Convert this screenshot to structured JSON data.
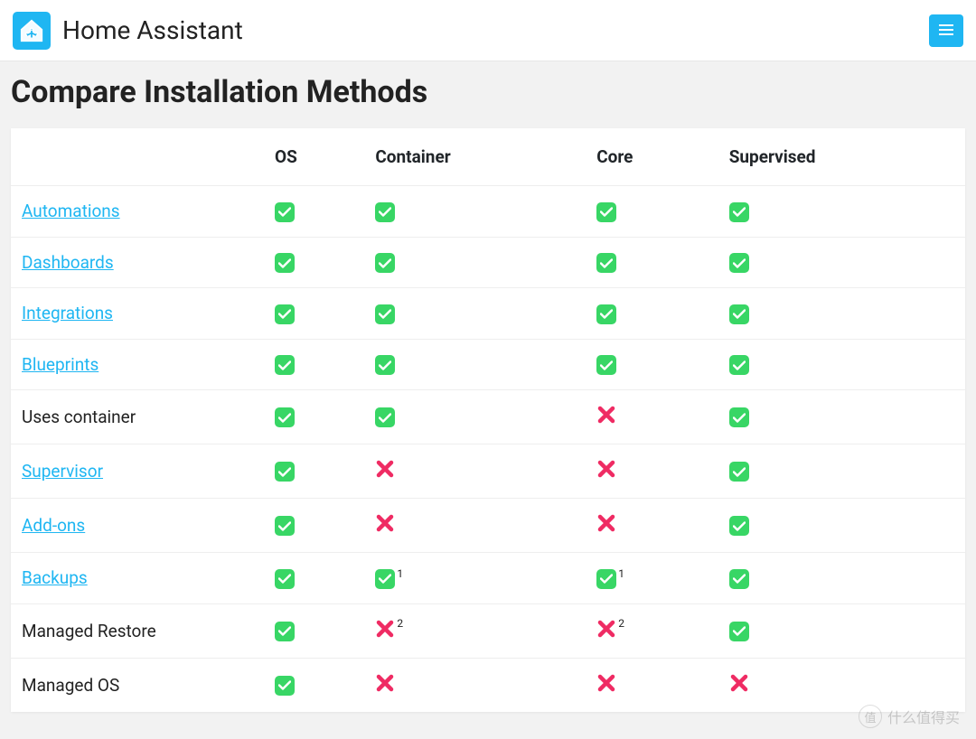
{
  "brand": "Home Assistant",
  "page_title": "Compare Installation Methods",
  "columns": {
    "c1": "OS",
    "c2": "Container",
    "c3": "Core",
    "c4": "Supervised"
  },
  "rows": [
    {
      "label": "Automations",
      "link": true,
      "cells": [
        [
          "yes",
          ""
        ],
        [
          "yes",
          ""
        ],
        [
          "yes",
          ""
        ],
        [
          "yes",
          ""
        ]
      ]
    },
    {
      "label": "Dashboards",
      "link": true,
      "cells": [
        [
          "yes",
          ""
        ],
        [
          "yes",
          ""
        ],
        [
          "yes",
          ""
        ],
        [
          "yes",
          ""
        ]
      ]
    },
    {
      "label": "Integrations",
      "link": true,
      "cells": [
        [
          "yes",
          ""
        ],
        [
          "yes",
          ""
        ],
        [
          "yes",
          ""
        ],
        [
          "yes",
          ""
        ]
      ]
    },
    {
      "label": "Blueprints",
      "link": true,
      "cells": [
        [
          "yes",
          ""
        ],
        [
          "yes",
          ""
        ],
        [
          "yes",
          ""
        ],
        [
          "yes",
          ""
        ]
      ]
    },
    {
      "label": "Uses container",
      "link": false,
      "cells": [
        [
          "yes",
          ""
        ],
        [
          "yes",
          ""
        ],
        [
          "no",
          ""
        ],
        [
          "yes",
          ""
        ]
      ]
    },
    {
      "label": "Supervisor",
      "link": true,
      "cells": [
        [
          "yes",
          ""
        ],
        [
          "no",
          ""
        ],
        [
          "no",
          ""
        ],
        [
          "yes",
          ""
        ]
      ]
    },
    {
      "label": "Add-ons",
      "link": true,
      "cells": [
        [
          "yes",
          ""
        ],
        [
          "no",
          ""
        ],
        [
          "no",
          ""
        ],
        [
          "yes",
          ""
        ]
      ]
    },
    {
      "label": "Backups",
      "link": true,
      "cells": [
        [
          "yes",
          ""
        ],
        [
          "yes",
          "1"
        ],
        [
          "yes",
          "1"
        ],
        [
          "yes",
          ""
        ]
      ]
    },
    {
      "label": "Managed Restore",
      "link": false,
      "cells": [
        [
          "yes",
          ""
        ],
        [
          "no",
          "2"
        ],
        [
          "no",
          "2"
        ],
        [
          "yes",
          ""
        ]
      ]
    },
    {
      "label": "Managed OS",
      "link": false,
      "cells": [
        [
          "yes",
          ""
        ],
        [
          "no",
          ""
        ],
        [
          "no",
          ""
        ],
        [
          "no",
          ""
        ]
      ]
    }
  ],
  "watermark": "什么值得买"
}
